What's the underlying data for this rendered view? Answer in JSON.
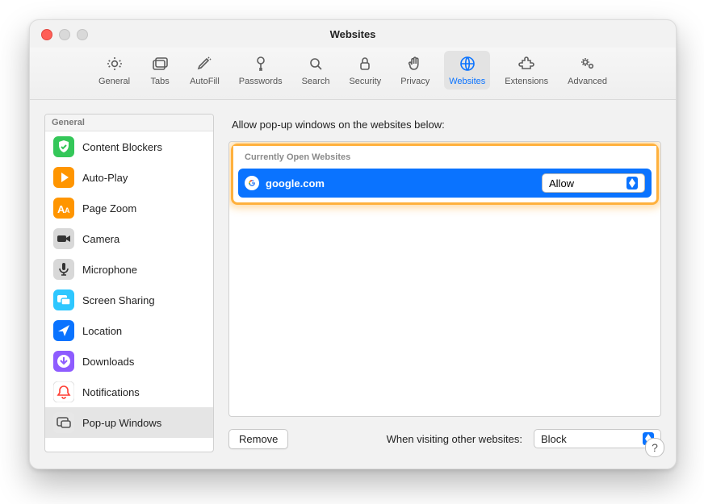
{
  "window": {
    "title": "Websites"
  },
  "toolbar": [
    {
      "label": "General"
    },
    {
      "label": "Tabs"
    },
    {
      "label": "AutoFill"
    },
    {
      "label": "Passwords"
    },
    {
      "label": "Search"
    },
    {
      "label": "Security"
    },
    {
      "label": "Privacy"
    },
    {
      "label": "Websites"
    },
    {
      "label": "Extensions"
    },
    {
      "label": "Advanced"
    }
  ],
  "sidebar": {
    "header": "General",
    "items": [
      {
        "label": "Content Blockers"
      },
      {
        "label": "Auto-Play"
      },
      {
        "label": "Page Zoom"
      },
      {
        "label": "Camera"
      },
      {
        "label": "Microphone"
      },
      {
        "label": "Screen Sharing"
      },
      {
        "label": "Location"
      },
      {
        "label": "Downloads"
      },
      {
        "label": "Notifications"
      },
      {
        "label": "Pop-up Windows"
      }
    ],
    "selected_index": 9
  },
  "content": {
    "instruction": "Allow pop-up windows on the websites below:",
    "list_header": "Currently Open Websites",
    "rows": [
      {
        "domain": "google.com",
        "permission": "Allow"
      }
    ],
    "remove_label": "Remove",
    "other_label": "When visiting other websites:",
    "other_value": "Block"
  }
}
